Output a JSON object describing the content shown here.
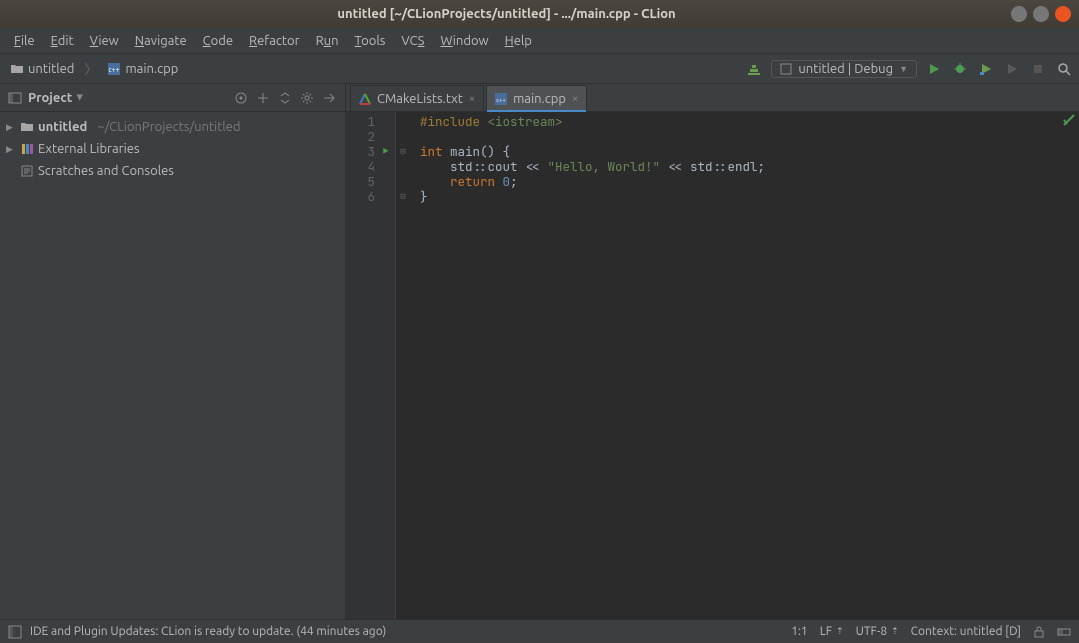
{
  "window": {
    "title": "untitled [~/CLionProjects/untitled] - .../main.cpp - CLion"
  },
  "menu": {
    "items": [
      "File",
      "Edit",
      "View",
      "Navigate",
      "Code",
      "Refactor",
      "Run",
      "Tools",
      "VCS",
      "Window",
      "Help"
    ]
  },
  "breadcrumb": {
    "project": "untitled",
    "file": "main.cpp"
  },
  "run_config": {
    "label": "untitled | Debug"
  },
  "project_tool": {
    "title": "Project",
    "tree": {
      "root": {
        "name": "untitled",
        "path": "~/CLionProjects/untitled"
      },
      "external_libs": "External Libraries",
      "scratches": "Scratches and Consoles"
    }
  },
  "editor": {
    "tabs": [
      {
        "label": "CMakeLists.txt",
        "active": false
      },
      {
        "label": "main.cpp",
        "active": true
      }
    ],
    "lines": [
      "1",
      "2",
      "3",
      "4",
      "5",
      "6"
    ],
    "code": {
      "l1_pre": "#include",
      "l1_inc": " <iostream>",
      "l3_kw": "int",
      "l3_rest": " main() {",
      "l4_indent": "    std::cout << ",
      "l4_str": "\"Hello, World!\"",
      "l4_rest": " << std::endl;",
      "l5_indent": "    ",
      "l5_kw": "return",
      "l5_rest": " ",
      "l5_num": "0",
      "l5_semi": ";",
      "l6": "}"
    }
  },
  "status": {
    "message": "IDE and Plugin Updates: CLion is ready to update. (44 minutes ago)",
    "pos": "1:1",
    "line_sep": "LF",
    "encoding": "UTF-8",
    "context": "Context: untitled [D]"
  }
}
